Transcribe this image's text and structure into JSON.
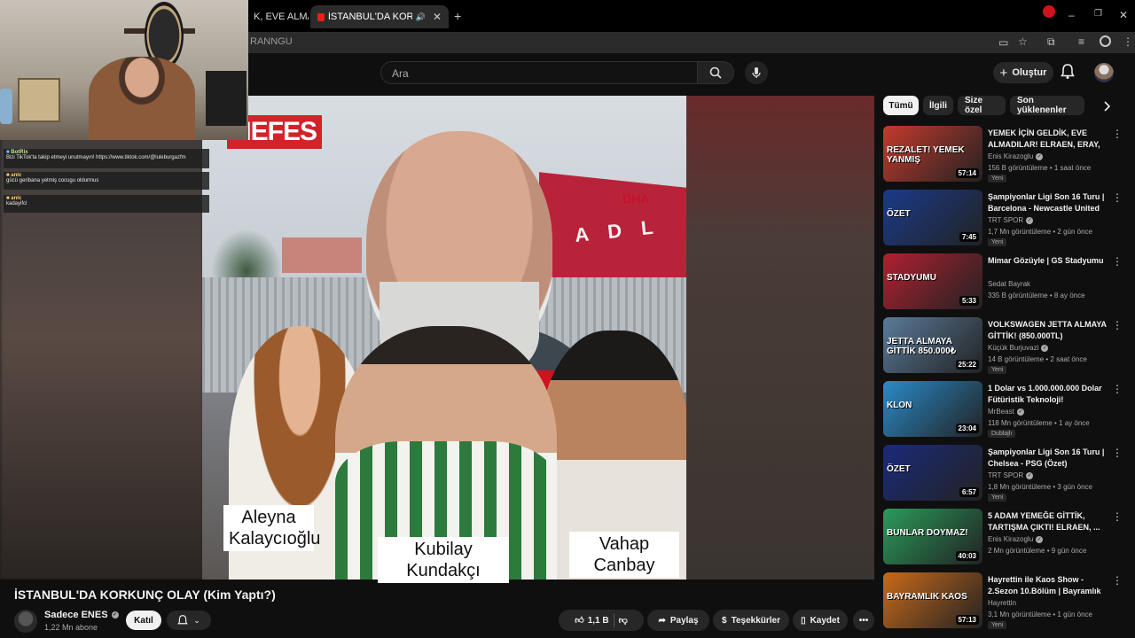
{
  "browser": {
    "tabs": [
      {
        "label": "K, EVE ALMA",
        "active": false
      },
      {
        "label": "İSTANBUL'DA KORKUNÇ OL",
        "active": true
      }
    ],
    "url_fragment": "RANNGU"
  },
  "header": {
    "search_placeholder": "Ara",
    "create_label": "Oluştur"
  },
  "stream_chat": [
    {
      "user": "BotRix",
      "message": "Bizi TikTok'ta takip etmeyi unutmayın! https://www.tiktok.com/@luleburgazfm"
    },
    {
      "user": "anlc",
      "message": "gücü geribana yetmiş cocugu oldurmus"
    },
    {
      "user": "anlc",
      "message": "kadayifci"
    }
  ],
  "video": {
    "title": "İSTANBUL'DA KORKUNÇ OLAY (Kim Yaptı?)",
    "overlay_brand": "NEFES",
    "gate_text": "A D L",
    "sign_text": "DHA",
    "mic_text": "DHA",
    "names": [
      "Aleyna Kalaycıoğlu",
      "Kubilay Kundakçı",
      "Vahap Canbay"
    ]
  },
  "channel": {
    "name": "Sadece ENES",
    "subscribers": "1,22 Mn abone",
    "join_label": "Katıl"
  },
  "actions": {
    "likes": "1,1 B",
    "share": "Paylaş",
    "thanks": "Teşekkürler",
    "save": "Kaydet"
  },
  "chips": [
    "Tümü",
    "İlgili",
    "Size özel",
    "Son yüklenenler"
  ],
  "recommendations": [
    {
      "title": "YEMEK İÇİN GELDİK, EVE ALMADILAR! ELRAEN, ERAY, ...",
      "channel": "Enis Kirazoglu",
      "meta": "156 B görüntüleme • 1 saat önce",
      "badge": "Yeni",
      "duration": "57:14",
      "thumb_text": "REZALET! YEMEK YANMIŞ",
      "color": "#c43a2c",
      "verified": true
    },
    {
      "title": "Şampiyonlar Ligi Son 16 Turu | Barcelona - Newcastle United ...",
      "channel": "TRT SPOR",
      "meta": "1,7 Mn görüntüleme • 2 gün önce",
      "badge": "Yeni",
      "duration": "7:45",
      "thumb_text": "ÖZET",
      "color": "#1a3a8a",
      "verified": true
    },
    {
      "title": "Mimar Gözüyle | GS Stadyumu",
      "channel": "Sedat Bayrak",
      "meta": "335 B görüntüleme • 8 ay önce",
      "badge": "",
      "duration": "5:33",
      "thumb_text": "STADYUMU",
      "color": "#b02030",
      "verified": false
    },
    {
      "title": "VOLKSWAGEN JETTA ALMAYA GİTTİK! (850.000TL)",
      "channel": "Küçük Burjuvazi",
      "meta": "14 B görüntüleme • 2 saat önce",
      "badge": "Yeni",
      "duration": "25:22",
      "thumb_text": "JETTA ALMAYA GİTTİK 850.000₺",
      "color": "#5a7a9a",
      "verified": true
    },
    {
      "title": "1 Dolar vs 1.000.000.000 Dolar Fütüristik Teknoloji!",
      "channel": "MrBeast",
      "meta": "118 Mn görüntüleme • 1 ay önce",
      "badge": "Dublajlı",
      "duration": "23:04",
      "thumb_text": "KLON",
      "color": "#2a8ac8",
      "verified": true
    },
    {
      "title": "Şampiyonlar Ligi Son 16 Turu | Chelsea - PSG (Özet)",
      "channel": "TRT SPOR",
      "meta": "1,8 Mn görüntüleme • 3 gün önce",
      "badge": "Yeni",
      "duration": "6:57",
      "thumb_text": "ÖZET",
      "color": "#1a2a7a",
      "verified": true
    },
    {
      "title": "5 ADAM YEMEĞE GİTTİK, TARTIŞMA ÇIKTI! ELRAEN, ...",
      "channel": "Enis Kirazoglu",
      "meta": "2 Mn görüntüleme • 9 gün önce",
      "badge": "",
      "duration": "40:03",
      "thumb_text": "BUNLAR DOYMAZ!",
      "color": "#2a9a5a",
      "verified": true
    },
    {
      "title": "Hayrettin ile Kaos Show - 2.Sezon 10.Bölüm | Bayramlık ...",
      "channel": "Hayrettin",
      "meta": "3,1 Mn görüntüleme • 1 gün önce",
      "badge": "Yeni",
      "duration": "57:13",
      "thumb_text": "BAYRAMLIK KAOS",
      "color": "#c86a1a",
      "verified": false
    }
  ]
}
